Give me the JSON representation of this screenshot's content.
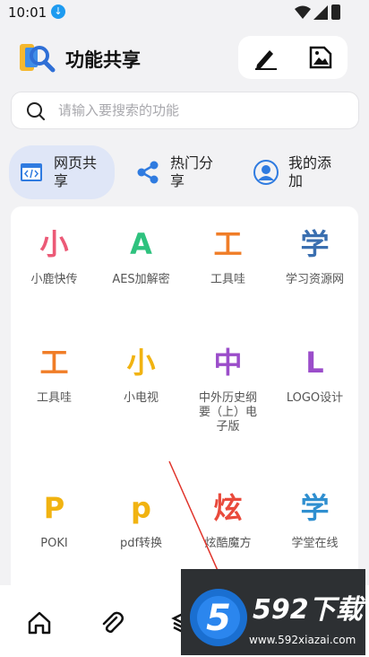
{
  "status_bar": {
    "time": "10:01"
  },
  "header": {
    "title": "功能共享"
  },
  "search": {
    "placeholder": "请输入要搜索的功能"
  },
  "tabs": [
    {
      "label": "网页共享",
      "icon": "web-code-icon",
      "active": true
    },
    {
      "label": "热门分享",
      "icon": "share-icon",
      "active": false
    },
    {
      "label": "我的添加",
      "icon": "user-icon",
      "active": false
    }
  ],
  "grid_items": [
    {
      "glyph": "小",
      "name": "小鹿快传",
      "color": "#ec5a77"
    },
    {
      "glyph": "A",
      "name": "AES加解密",
      "color": "#2ec27e"
    },
    {
      "glyph": "工",
      "name": "工具哇",
      "color": "#f07d27"
    },
    {
      "glyph": "学",
      "name": "学习资源网",
      "color": "#3a6fb0"
    },
    {
      "glyph": "工",
      "name": "工具哇",
      "color": "#f07d27"
    },
    {
      "glyph": "小",
      "name": "小电视",
      "color": "#f1b311"
    },
    {
      "glyph": "中",
      "name": "中外历史纲要（上）电子版",
      "color": "#9b4dca"
    },
    {
      "glyph": "L",
      "name": "LOGO设计",
      "color": "#9b4dca"
    },
    {
      "glyph": "P",
      "name": "POKI",
      "color": "#f1b311"
    },
    {
      "glyph": "p",
      "name": "pdf转换",
      "color": "#f1b311"
    },
    {
      "glyph": "炫",
      "name": "炫酷魔方",
      "color": "#e94a3c"
    },
    {
      "glyph": "学",
      "name": "学堂在线",
      "color": "#2f8fd0"
    }
  ],
  "bottom_nav": [
    {
      "icon": "home-icon"
    },
    {
      "icon": "paperclip-icon"
    },
    {
      "icon": "layers-icon"
    }
  ],
  "watermark": {
    "brand": "592下载",
    "url": "www.592xiazai.com",
    "logo_text": "5"
  }
}
